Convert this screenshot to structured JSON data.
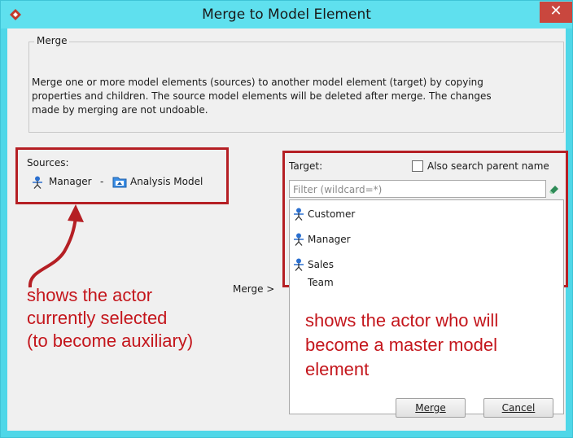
{
  "window": {
    "title": "Merge to Model Element",
    "close_glyph": "✕",
    "title_bg": "#5fe0ee",
    "app_icon": "diamond-logo-icon"
  },
  "merge_group": {
    "legend": "Merge",
    "description_line1": "Merge one or more model elements (sources) to another model element (target) by copying",
    "description_line2": "properties and children. The source model elements will be deleted after merge. The changes",
    "description_line3": "made by merging are not undoable."
  },
  "sources": {
    "label": "Sources:",
    "item_name": "Manager",
    "separator": "-",
    "model_name": "Analysis Model",
    "item_icon": "actor-icon",
    "model_icon": "model-folder-icon"
  },
  "target": {
    "label": "Target:",
    "also_search_label": "Also search parent name",
    "also_search_checked": false,
    "filter_placeholder": "Filter (wildcard=*)",
    "items": [
      {
        "label": "Customer",
        "icon": "actor-icon"
      },
      {
        "label": "Manager",
        "icon": "actor-icon"
      },
      {
        "label": "Sales Team",
        "icon": "actor-icon"
      }
    ]
  },
  "merge_arrow_label": "Merge >",
  "annotations": {
    "left_line1": "shows the actor",
    "left_line2": "currently selected",
    "left_line3": "(to become auxiliary)",
    "right_line1": "shows the actor who will",
    "right_line2": "become a master model",
    "right_line3": "element",
    "color": "#c4161c"
  },
  "buttons": {
    "merge": "Merge",
    "cancel": "Cancel"
  }
}
